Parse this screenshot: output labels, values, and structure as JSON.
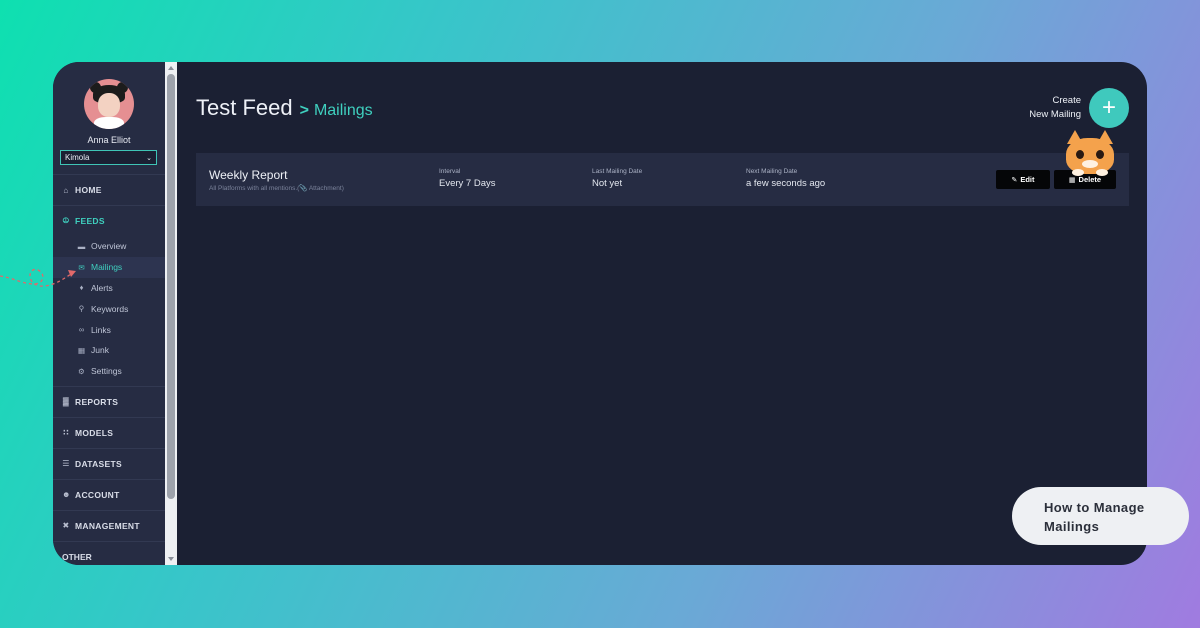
{
  "user": {
    "name": "Anna Elliot",
    "workspace": "Kimola"
  },
  "nav": {
    "home": {
      "label": "HOME",
      "icon": "home-icon"
    },
    "feeds": {
      "label": "FEEDS",
      "icon": "feeds-icon",
      "items": [
        {
          "label": "Overview",
          "icon": "overview-icon",
          "active": false
        },
        {
          "label": "Mailings",
          "icon": "mailings-icon",
          "active": true
        },
        {
          "label": "Alerts",
          "icon": "bell-icon",
          "active": false
        },
        {
          "label": "Keywords",
          "icon": "key-icon",
          "active": false
        },
        {
          "label": "Links",
          "icon": "link-icon",
          "active": false
        },
        {
          "label": "Junk",
          "icon": "trash-icon",
          "active": false
        },
        {
          "label": "Settings",
          "icon": "gear-icon",
          "active": false
        }
      ]
    },
    "reports": {
      "label": "REPORTS",
      "icon": "bar-chart-icon"
    },
    "models": {
      "label": "MODELS",
      "icon": "models-icon"
    },
    "datasets": {
      "label": "DATASETS",
      "icon": "datasets-icon"
    },
    "account": {
      "label": "ACCOUNT",
      "icon": "account-icon"
    },
    "management": {
      "label": "MANAGEMENT",
      "icon": "tools-icon"
    },
    "other": {
      "label": "OTHER"
    }
  },
  "header": {
    "feed_title": "Test Feed",
    "breadcrumb_sep": ">",
    "breadcrumb": "Mailings",
    "create_line1": "Create",
    "create_line2": "New Mailing",
    "create_icon": "+"
  },
  "mailing": {
    "name": "Weekly Report",
    "description": "All Platforms with all mentions.(📎 Attachment)",
    "interval_label": "Interval",
    "interval_value": "Every 7 Days",
    "last_label": "Last Mailing Date",
    "last_value": "Not yet",
    "next_label": "Next Mailing Date",
    "next_value": "a few seconds ago",
    "edit_label": "Edit",
    "delete_label": "Delete"
  },
  "overlay": {
    "line1": "How to Manage",
    "line2": "Mailings"
  },
  "colors": {
    "accent": "#3fc9bd",
    "panel": "#1b2033",
    "sidebar": "#262c43"
  }
}
